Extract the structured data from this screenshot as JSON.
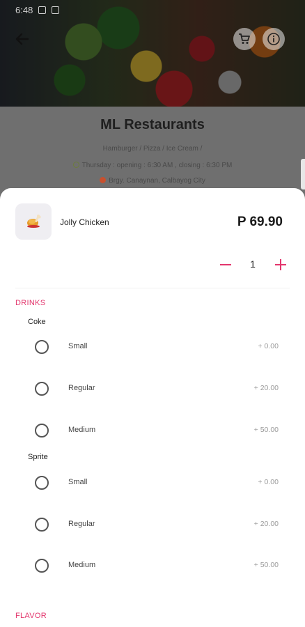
{
  "status_bar": {
    "time": "6:48"
  },
  "restaurant": {
    "name": "ML Restaurants",
    "tags": "Hamburger / Pizza / Ice Cream /",
    "hours": "Thursday : opening : 6:30 AM , closing : 6:30 PM",
    "address": "Brgy. Canaynan, Calbayog City"
  },
  "item": {
    "name": "Jolly Chicken",
    "price": "P 69.90",
    "quantity": "1"
  },
  "sections": [
    {
      "title": "DRINKS",
      "groups": [
        {
          "name": "Coke",
          "options": [
            {
              "label": "Small",
              "price": "+ 0.00"
            },
            {
              "label": "Regular",
              "price": "+ 20.00"
            },
            {
              "label": "Medium",
              "price": "+ 50.00"
            }
          ]
        },
        {
          "name": "Sprite",
          "options": [
            {
              "label": "Small",
              "price": "+ 0.00"
            },
            {
              "label": "Regular",
              "price": "+ 20.00"
            },
            {
              "label": "Medium",
              "price": "+ 50.00"
            }
          ]
        }
      ]
    },
    {
      "title": "FLAVOR",
      "groups": []
    }
  ],
  "colors": {
    "accent": "#e3366d"
  },
  "icons": {
    "back": "arrow-left-icon",
    "cart": "cart-icon",
    "info": "info-icon",
    "clock": "clock-icon",
    "location": "location-pin-icon"
  }
}
